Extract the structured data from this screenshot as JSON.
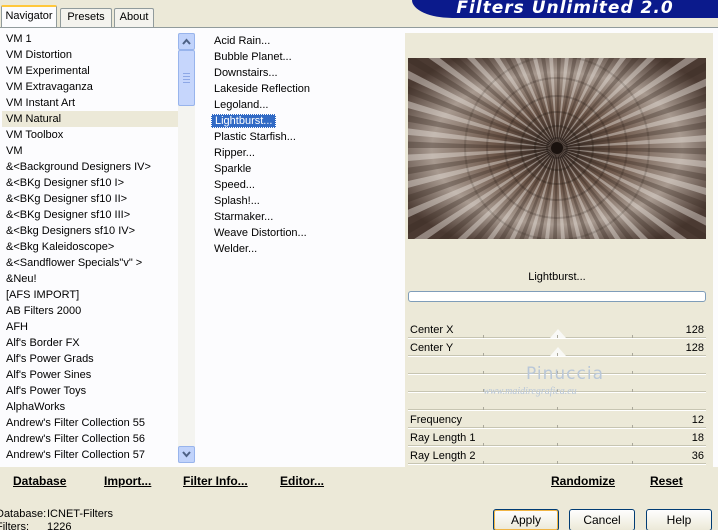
{
  "tabs": [
    {
      "label": "Navigator",
      "active": true
    },
    {
      "label": "Presets",
      "active": false
    },
    {
      "label": "About",
      "active": false
    }
  ],
  "app_title": "Filters Unlimited 2.0",
  "categories": [
    "VM 1",
    "VM Distortion",
    "VM Experimental",
    "VM Extravaganza",
    "VM Instant Art",
    "VM Natural",
    "VM Toolbox",
    "VM",
    "&<Background Designers IV>",
    "&<BKg Designer sf10 I>",
    "&<BKg Designer sf10 II>",
    "&<BKg Designer sf10 III>",
    "&<Bkg Designers sf10 IV>",
    "&<Bkg Kaleidoscope>",
    "&<Sandflower Specials\"v\" >",
    "&Neu!",
    "[AFS IMPORT]",
    "AB Filters 2000",
    "AFH",
    "Alf's Border FX",
    "Alf's Power Grads",
    "Alf's Power Sines",
    "Alf's Power Toys",
    "AlphaWorks",
    "Andrew's Filter Collection 55",
    "Andrew's Filter Collection 56",
    "Andrew's Filter Collection 57"
  ],
  "selected_category": "VM Natural",
  "filters": [
    "Acid Rain...",
    "Bubble Planet...",
    "Downstairs...",
    "Lakeside Reflection",
    "Legoland...",
    "Lightburst...",
    "Plastic Starfish...",
    "Ripper...",
    "Sparkle",
    "Speed...",
    "Splash!...",
    "Starmaker...",
    "Weave Distortion...",
    "Welder..."
  ],
  "selected_filter": "Lightburst...",
  "preview_filter_name": "Lightburst...",
  "progress": 0,
  "params_top": [
    {
      "label": "Center X",
      "value": "128",
      "level": 0.5
    },
    {
      "label": "Center Y",
      "value": "128",
      "level": 0.5
    }
  ],
  "params_bottom": [
    {
      "label": "Frequency",
      "value": "12"
    },
    {
      "label": "Ray Length 1",
      "value": "18"
    },
    {
      "label": "Ray Length 2",
      "value": "36"
    }
  ],
  "watermark": {
    "name": "Pinuccia",
    "site": "www.maidiregrafica.eu"
  },
  "links": {
    "database": "Database",
    "import": "Import...",
    "filter_info": "Filter Info...",
    "editor": "Editor...",
    "randomize": "Randomize",
    "reset": "Reset"
  },
  "status": {
    "database_label": "Database:",
    "database_value": "ICNET-Filters",
    "filters_label": "Filters:",
    "filters_value": "1226"
  },
  "buttons": {
    "apply": "Apply",
    "cancel": "Cancel",
    "help": "Help"
  },
  "colors": {
    "selection": "#316ac5",
    "title_bar": "#0b1a8c",
    "panel": "#ece9d8"
  }
}
